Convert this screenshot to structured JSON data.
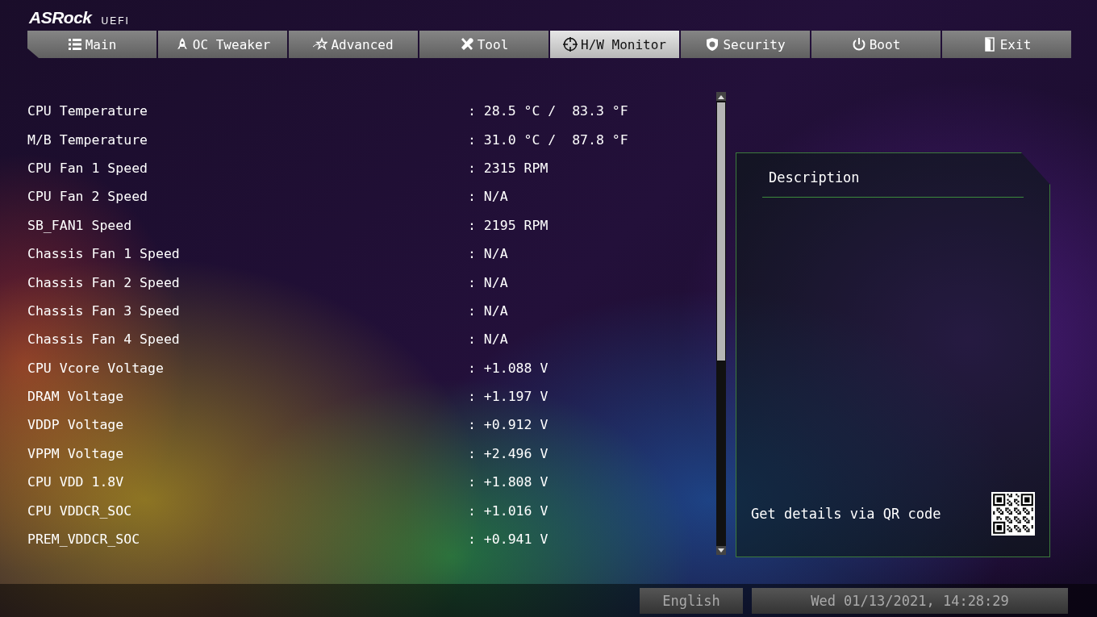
{
  "header": {
    "logo": "ASRock",
    "logo_suffix": "UEFI"
  },
  "tabs": [
    {
      "label": "Main",
      "kind": "main",
      "selected": false
    },
    {
      "label": "OC Tweaker",
      "kind": "oc",
      "selected": false
    },
    {
      "label": "Advanced",
      "kind": "advanced",
      "selected": false
    },
    {
      "label": "Tool",
      "kind": "tool",
      "selected": false
    },
    {
      "label": "H/W Monitor",
      "kind": "monitor",
      "selected": true
    },
    {
      "label": "Security",
      "kind": "security",
      "selected": false
    },
    {
      "label": "Boot",
      "kind": "boot",
      "selected": false
    },
    {
      "label": "Exit",
      "kind": "exit",
      "selected": false
    }
  ],
  "readings": [
    {
      "name": "CPU Temperature",
      "value": ": 28.5 °C /  83.3 °F"
    },
    {
      "name": "M/B Temperature",
      "value": ": 31.0 °C /  87.8 °F"
    },
    {
      "name": "CPU Fan 1 Speed",
      "value": ": 2315 RPM"
    },
    {
      "name": "CPU Fan 2 Speed",
      "value": ": N/A"
    },
    {
      "name": "SB_FAN1 Speed",
      "value": ": 2195 RPM"
    },
    {
      "name": "Chassis Fan 1 Speed",
      "value": ": N/A"
    },
    {
      "name": "Chassis Fan 2 Speed",
      "value": ": N/A"
    },
    {
      "name": "Chassis Fan 3 Speed",
      "value": ": N/A"
    },
    {
      "name": "Chassis Fan 4 Speed",
      "value": ": N/A"
    },
    {
      "name": "CPU Vcore Voltage",
      "value": ": +1.088 V"
    },
    {
      "name": "DRAM Voltage",
      "value": ": +1.197 V"
    },
    {
      "name": "VDDP Voltage",
      "value": ": +0.912 V"
    },
    {
      "name": "VPPM Voltage",
      "value": ": +2.496 V"
    },
    {
      "name": "CPU VDD 1.8V",
      "value": ": +1.808 V"
    },
    {
      "name": "CPU VDDCR_SOC",
      "value": ": +1.016 V"
    },
    {
      "name": "PREM_VDDCR_SOC",
      "value": ": +0.941 V"
    }
  ],
  "description": {
    "title": "Description",
    "qr_hint": "Get details via QR code"
  },
  "status_bar": {
    "language": "English",
    "datetime": "Wed 01/13/2021, 14:28:29"
  }
}
